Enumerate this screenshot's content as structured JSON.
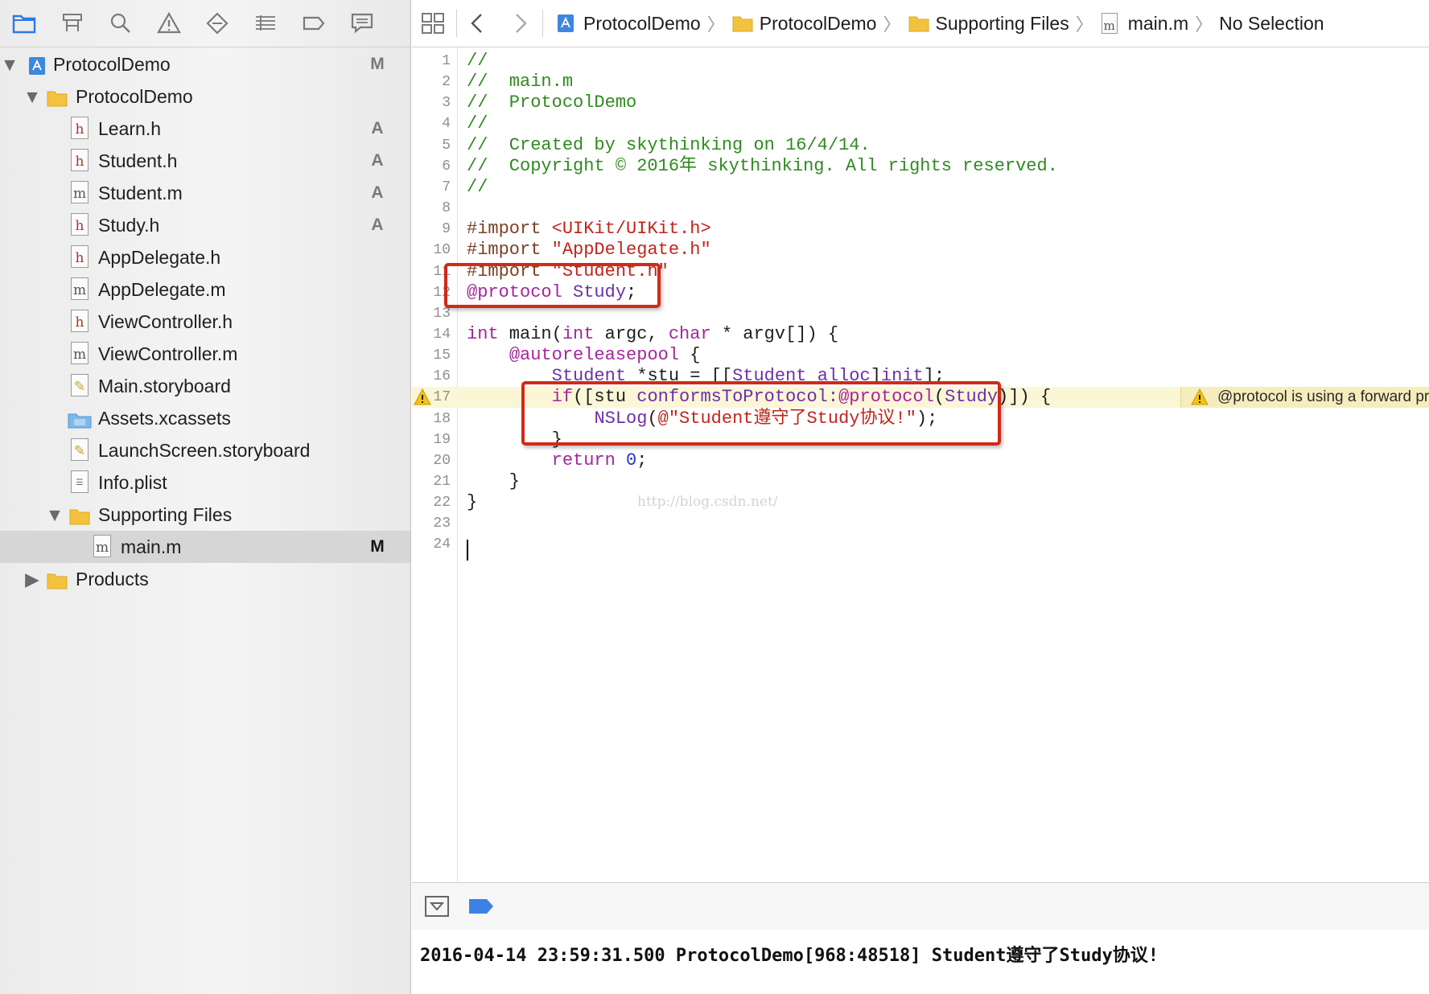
{
  "navigator": {
    "toolbar_icons": [
      "folder-icon",
      "hierarchy-icon",
      "search-icon",
      "warning-icon",
      "diamond-icon",
      "list-icon",
      "label-icon",
      "speech-bubble-icon"
    ],
    "tree": [
      {
        "label": "ProtocolDemo",
        "badge": "M",
        "kind": "project",
        "expanded": true
      },
      {
        "label": "ProtocolDemo",
        "badge": "",
        "kind": "folder",
        "expanded": true
      },
      {
        "label": "Learn.h",
        "badge": "A",
        "kind": "h"
      },
      {
        "label": "Student.h",
        "badge": "A",
        "kind": "h"
      },
      {
        "label": "Student.m",
        "badge": "A",
        "kind": "m"
      },
      {
        "label": "Study.h",
        "badge": "A",
        "kind": "h"
      },
      {
        "label": "AppDelegate.h",
        "badge": "",
        "kind": "h"
      },
      {
        "label": "AppDelegate.m",
        "badge": "",
        "kind": "m"
      },
      {
        "label": "ViewController.h",
        "badge": "",
        "kind": "h"
      },
      {
        "label": "ViewController.m",
        "badge": "",
        "kind": "m"
      },
      {
        "label": "Main.storyboard",
        "badge": "",
        "kind": "storyboard"
      },
      {
        "label": "Assets.xcassets",
        "badge": "",
        "kind": "assets"
      },
      {
        "label": "LaunchScreen.storyboard",
        "badge": "",
        "kind": "storyboard"
      },
      {
        "label": "Info.plist",
        "badge": "",
        "kind": "plist"
      },
      {
        "label": "Supporting Files",
        "badge": "",
        "kind": "folder",
        "expanded": true
      },
      {
        "label": "main.m",
        "badge": "M",
        "kind": "m",
        "selected": true
      },
      {
        "label": "Products",
        "badge": "",
        "kind": "folder",
        "expanded": false
      }
    ]
  },
  "jump_bar": {
    "project": "ProtocolDemo",
    "group": "ProtocolDemo",
    "subgroup": "Supporting Files",
    "file": "main.m",
    "symbol": "No Selection",
    "file_icon_letter": "m"
  },
  "code": {
    "lines": [
      {
        "n": "1",
        "tokens": [
          [
            "c",
            "//"
          ]
        ]
      },
      {
        "n": "2",
        "tokens": [
          [
            "c",
            "//  main.m"
          ]
        ]
      },
      {
        "n": "3",
        "tokens": [
          [
            "c",
            "//  ProtocolDemo"
          ]
        ]
      },
      {
        "n": "4",
        "tokens": [
          [
            "c",
            "//"
          ]
        ]
      },
      {
        "n": "5",
        "tokens": [
          [
            "c",
            "//  Created by skythinking on 16/4/14."
          ]
        ]
      },
      {
        "n": "6",
        "tokens": [
          [
            "c",
            "//  Copyright © 2016年 skythinking. All rights reserved."
          ]
        ]
      },
      {
        "n": "7",
        "tokens": [
          [
            "c",
            "//"
          ]
        ]
      },
      {
        "n": "8",
        "tokens": []
      },
      {
        "n": "9",
        "tokens": [
          [
            "p",
            "#import "
          ],
          [
            "s",
            "<UIKit/UIKit.h>"
          ]
        ]
      },
      {
        "n": "10",
        "tokens": [
          [
            "p",
            "#import "
          ],
          [
            "s",
            "\"AppDelegate.h\""
          ]
        ]
      },
      {
        "n": "11",
        "tokens": [
          [
            "p",
            "#import "
          ],
          [
            "s",
            "\"Student.h\""
          ]
        ]
      },
      {
        "n": "12",
        "tokens": [
          [
            "k",
            "@protocol"
          ],
          [
            "x",
            " "
          ],
          [
            "t",
            "Study"
          ],
          [
            "x",
            ";"
          ]
        ]
      },
      {
        "n": "13",
        "tokens": []
      },
      {
        "n": "14",
        "tokens": [
          [
            "k",
            "int"
          ],
          [
            "x",
            " main("
          ],
          [
            "k",
            "int"
          ],
          [
            "x",
            " argc, "
          ],
          [
            "k",
            "char"
          ],
          [
            "x",
            " * argv[]) {"
          ]
        ]
      },
      {
        "n": "15",
        "tokens": [
          [
            "x",
            "    "
          ],
          [
            "k",
            "@autoreleasepool"
          ],
          [
            "x",
            " {"
          ]
        ]
      },
      {
        "n": "16",
        "tokens": [
          [
            "x",
            "        "
          ],
          [
            "t",
            "Student"
          ],
          [
            "x",
            " *stu = [["
          ],
          [
            "t",
            "Student"
          ],
          [
            "x",
            " "
          ],
          [
            "t",
            "alloc"
          ],
          [
            "x",
            "]"
          ],
          [
            "t",
            "init"
          ],
          [
            "x",
            "];"
          ]
        ]
      },
      {
        "n": "17",
        "tokens": [
          [
            "x",
            "        "
          ],
          [
            "k",
            "if"
          ],
          [
            "x",
            "([stu "
          ],
          [
            "t",
            "conformsToProtocol:"
          ],
          [
            "k",
            "@protocol"
          ],
          [
            "x",
            "("
          ],
          [
            "t",
            "Study"
          ],
          [
            "x",
            ")]) {"
          ]
        ],
        "warning": true
      },
      {
        "n": "18",
        "tokens": [
          [
            "x",
            "            "
          ],
          [
            "t",
            "NSLog"
          ],
          [
            "x",
            "("
          ],
          [
            "s",
            "@\"Student遵守了Study协议!\""
          ],
          [
            "x",
            ");"
          ]
        ]
      },
      {
        "n": "19",
        "tokens": [
          [
            "x",
            "        }"
          ]
        ]
      },
      {
        "n": "20",
        "tokens": [
          [
            "x",
            "        "
          ],
          [
            "k",
            "return"
          ],
          [
            "x",
            " "
          ],
          [
            "d",
            "0"
          ],
          [
            "x",
            ";"
          ]
        ]
      },
      {
        "n": "21",
        "tokens": [
          [
            "x",
            "    }"
          ]
        ]
      },
      {
        "n": "22",
        "tokens": [
          [
            "x",
            "}"
          ]
        ]
      },
      {
        "n": "23",
        "tokens": []
      },
      {
        "n": "24",
        "tokens": []
      }
    ],
    "warning_message": "@protocol is using a forward protocol declaration",
    "watermark": "http://blog.csdn.net/"
  },
  "console": {
    "output": "2016-04-14 23:59:31.500 ProtocolDemo[968:48518] Student遵守了Study协议!"
  },
  "colors": {
    "comment": "#2f8a1f",
    "keyword": "#a4259c",
    "string": "#c0251a",
    "highlight_box": "#cf2b16",
    "warning_line": "#fbf6d6"
  }
}
